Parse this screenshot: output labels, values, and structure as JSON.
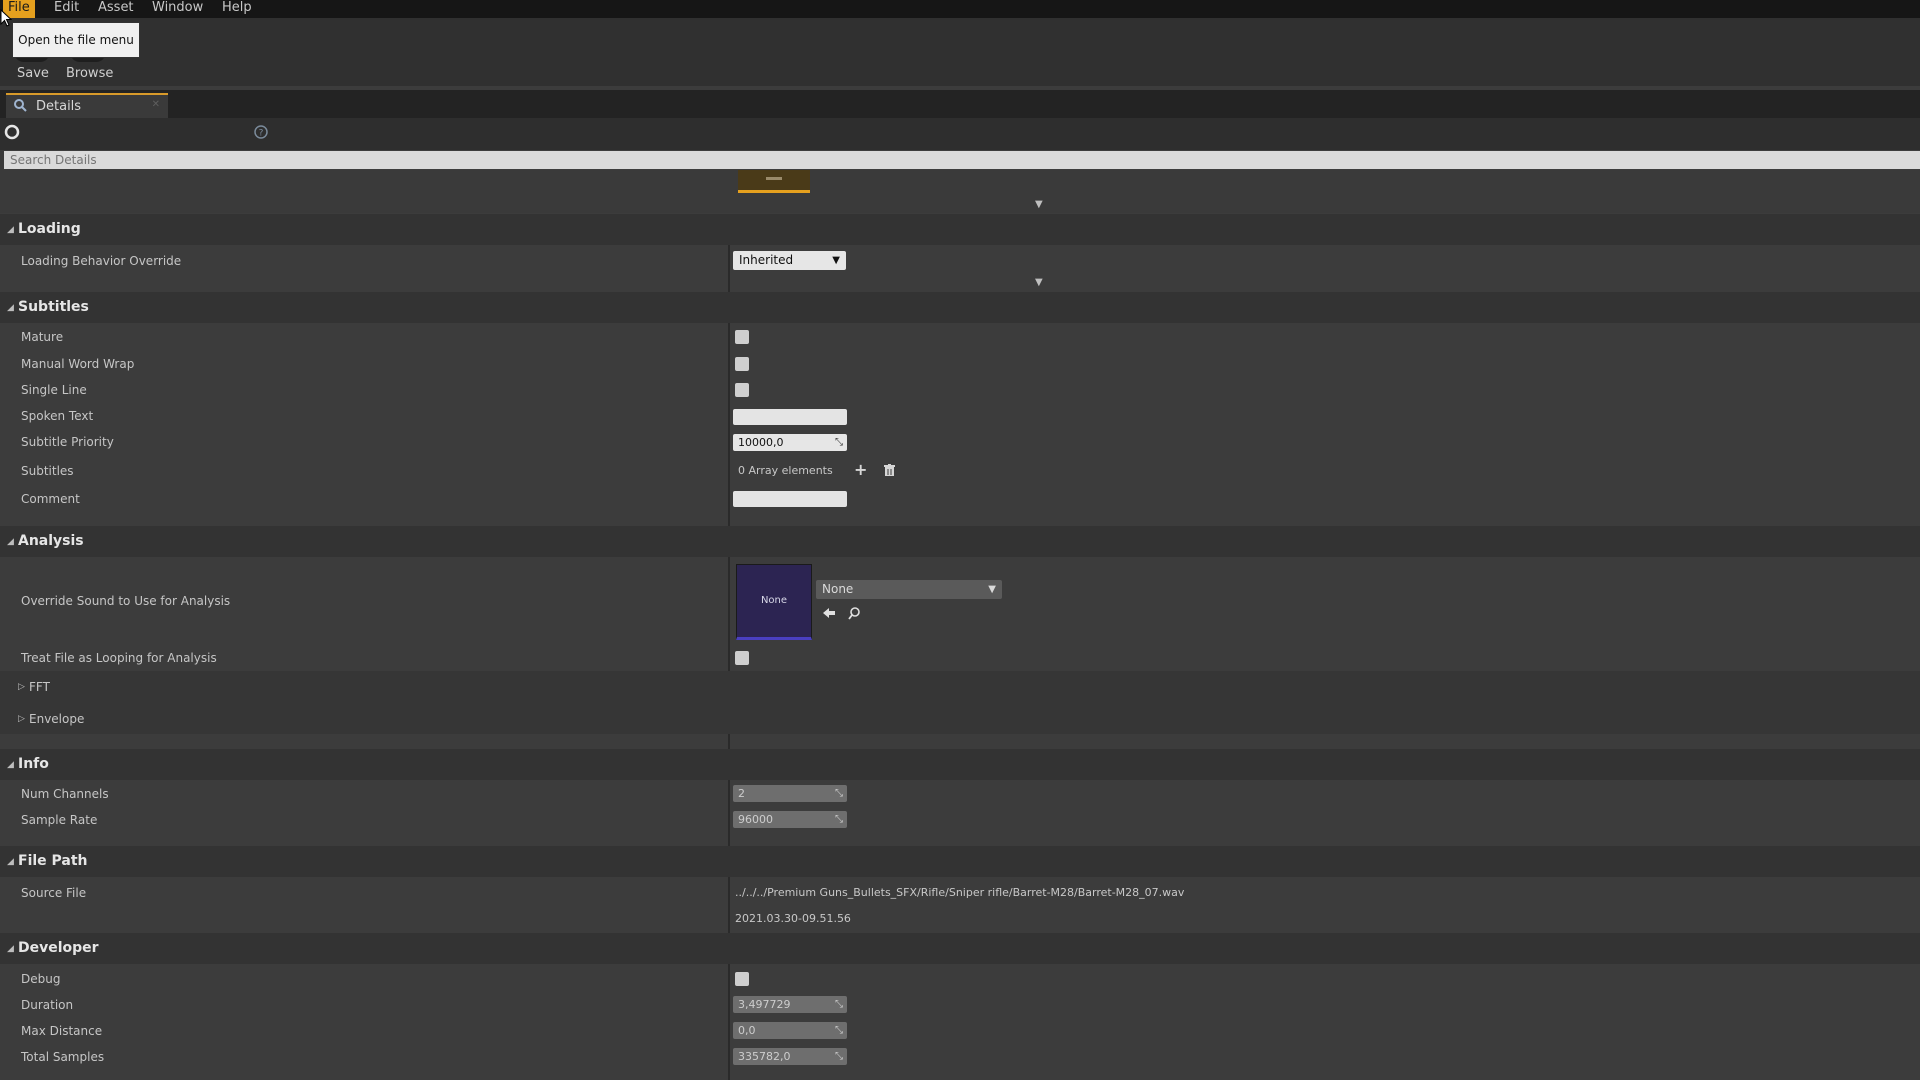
{
  "menu": {
    "items": [
      {
        "label": "File",
        "active": true
      },
      {
        "label": "Edit"
      },
      {
        "label": "Asset"
      },
      {
        "label": "Window"
      },
      {
        "label": "Help"
      }
    ],
    "tooltip": "Open the file menu"
  },
  "toolbar": {
    "save_label": "Save",
    "browse_label": "Browse"
  },
  "tab": {
    "label": "Details"
  },
  "search": {
    "placeholder": "Search Details"
  },
  "colors": {
    "accent": "#e5a01e",
    "thumbnail": "#2c2452",
    "thumbnail_underline": "#4a3fc0"
  },
  "details": {
    "loading": {
      "title": "Loading",
      "behavior_override_label": "Loading Behavior Override",
      "behavior_override_value": "Inherited"
    },
    "subtitles": {
      "title": "Subtitles",
      "mature_label": "Mature",
      "manual_word_wrap_label": "Manual Word Wrap",
      "single_line_label": "Single Line",
      "spoken_text_label": "Spoken Text",
      "subtitle_priority_label": "Subtitle Priority",
      "subtitle_priority_value": "10000,0",
      "subtitles_label": "Subtitles",
      "subtitles_value": "0 Array elements",
      "comment_label": "Comment"
    },
    "analysis": {
      "title": "Analysis",
      "override_sound_label": "Override Sound to Use for Analysis",
      "thumbnail_text": "None",
      "override_sound_value": "None",
      "treat_looping_label": "Treat File as Looping for Analysis",
      "fft_label": "FFT",
      "envelope_label": "Envelope"
    },
    "info": {
      "title": "Info",
      "num_channels_label": "Num Channels",
      "num_channels_value": "2",
      "sample_rate_label": "Sample Rate",
      "sample_rate_value": "96000"
    },
    "file_path": {
      "title": "File Path",
      "source_file_label": "Source File",
      "source_file_value": "../../../Premium Guns_Bullets_SFX/Rifle/Sniper rifle/Barret-M28/Barret-M28_07.wav",
      "timestamp": "2021.03.30-09.51.56"
    },
    "developer": {
      "title": "Developer",
      "debug_label": "Debug",
      "duration_label": "Duration",
      "duration_value": "3,497729",
      "max_distance_label": "Max Distance",
      "max_distance_value": "0,0",
      "total_samples_label": "Total Samples",
      "total_samples_value": "335782,0"
    }
  }
}
